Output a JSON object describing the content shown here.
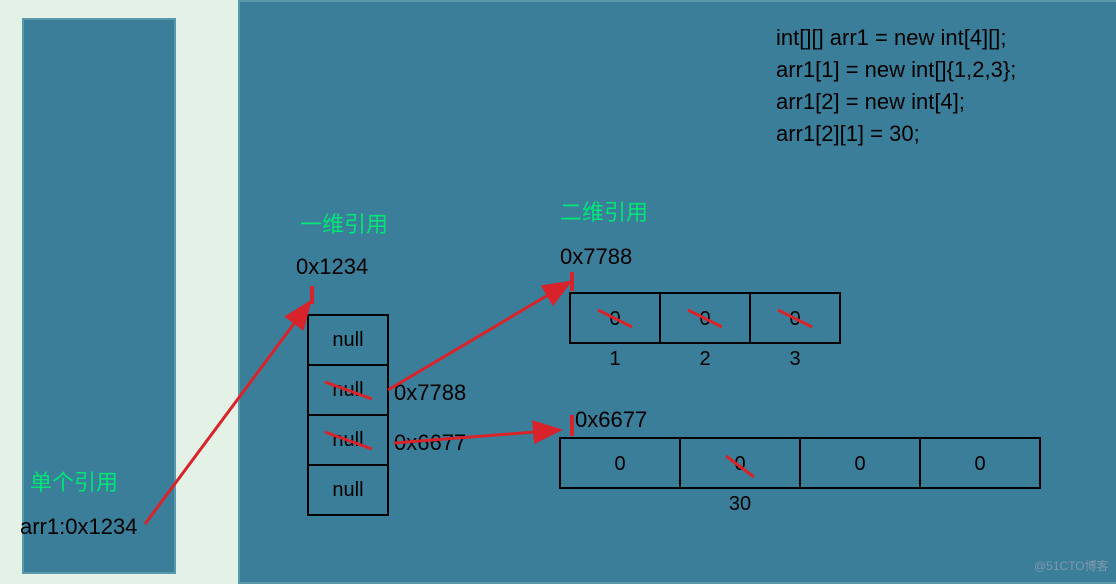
{
  "code": {
    "l1": "int[][] arr1 = new int[4][];",
    "l2": "arr1[1] = new int[]{1,2,3};",
    "l3": "arr1[2] = new int[4];",
    "l4": "arr1[2][1] = 30;"
  },
  "labels": {
    "single_ref": "单个引用",
    "dim1_ref": "一维引用",
    "dim2_ref": "二维引用"
  },
  "addrs": {
    "var": "arr1:0x1234",
    "outer": "0x1234",
    "row1": "0x7788",
    "row1_cell": "0x7788",
    "row2": "0x6677",
    "row2_cell": "0x6677"
  },
  "outer": [
    "null",
    "null",
    "null",
    "null"
  ],
  "row1": {
    "old": [
      "0",
      "0",
      "0"
    ],
    "idx": [
      "1",
      "2",
      "3"
    ]
  },
  "row2": {
    "vals": [
      "0",
      "0",
      "0",
      "0"
    ],
    "new_at1": "30"
  },
  "watermark": "@51CTO博客"
}
